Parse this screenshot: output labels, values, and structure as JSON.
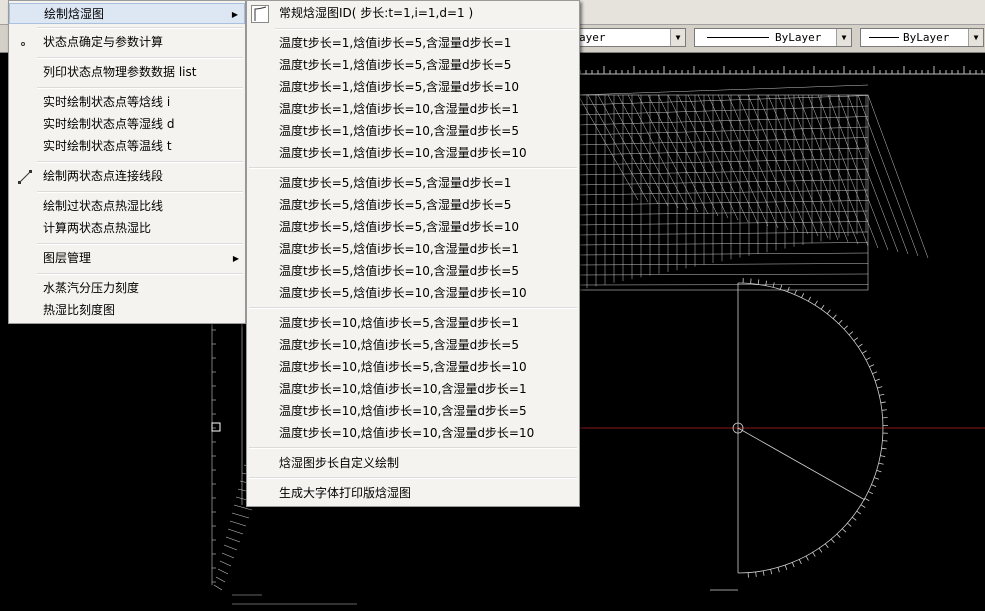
{
  "toolbar": {
    "combo1": "ayer",
    "combo2": "ByLayer",
    "combo3": "ByLayer"
  },
  "main_menu": {
    "items": [
      "绘制焓湿图",
      "状态点确定与参数计算",
      "列印状态点物理参数数据 list",
      "实时绘制状态点等焓线 i",
      "实时绘制状态点等湿线 d",
      "实时绘制状态点等温线 t",
      "绘制两状态点连接线段",
      "绘制过状态点热湿比线",
      "计算两状态点热湿比",
      "图层管理",
      "水蒸汽分压力刻度",
      "热湿比刻度图"
    ]
  },
  "sub_menu": {
    "items": [
      "常规焓湿图ID( 步长:t=1,i=1,d=1 )",
      "温度t步长=1,焓值i步长=5,含湿量d步长=1",
      "温度t步长=1,焓值i步长=5,含湿量d步长=5",
      "温度t步长=1,焓值i步长=5,含湿量d步长=10",
      "温度t步长=1,焓值i步长=10,含湿量d步长=1",
      "温度t步长=1,焓值i步长=10,含湿量d步长=5",
      "温度t步长=1,焓值i步长=10,含湿量d步长=10",
      "温度t步长=5,焓值i步长=5,含湿量d步长=1",
      "温度t步长=5,焓值i步长=5,含湿量d步长=5",
      "温度t步长=5,焓值i步长=5,含湿量d步长=10",
      "温度t步长=5,焓值i步长=10,含湿量d步长=1",
      "温度t步长=5,焓值i步长=10,含湿量d步长=5",
      "温度t步长=5,焓值i步长=10,含湿量d步长=10",
      "温度t步长=10,焓值i步长=5,含湿量d步长=1",
      "温度t步长=10,焓值i步长=5,含湿量d步长=5",
      "温度t步长=10,焓值i步长=5,含湿量d步长=10",
      "温度t步长=10,焓值i步长=10,含湿量d步长=1",
      "温度t步长=10,焓值i步长=10,含湿量d步长=5",
      "温度t步长=10,焓值i步长=10,含湿量d步长=10",
      "焓湿图步长自定义绘制",
      "生成大字体打印版焓湿图"
    ]
  },
  "colors": {
    "background": "#000000",
    "menu_bg": "#f4f3ef",
    "highlight": "#dde6f3",
    "crosshair_red": "#8b1a1a",
    "drawing_lines": "#c8c8c8"
  }
}
